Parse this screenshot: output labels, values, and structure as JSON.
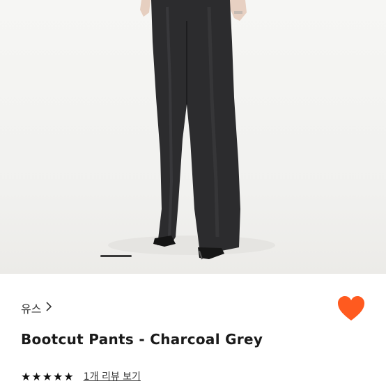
{
  "product": {
    "brand": "유스",
    "title": "Bootcut Pants - Charcoal Grey",
    "rating_stars": 5,
    "rating_max": 5,
    "review_link": "1개 리뷰 보기"
  },
  "gallery": {
    "active_index": 0,
    "image_alt": "charcoal grey bootcut pants on model"
  },
  "icons": {
    "brand_arrow": "chevron-right-icon",
    "wishlist": "heart-icon",
    "star": "star-icon"
  },
  "colors": {
    "accent": "#ff5a1f",
    "pants": "#2b2b2d",
    "text": "#1a1a1a"
  }
}
